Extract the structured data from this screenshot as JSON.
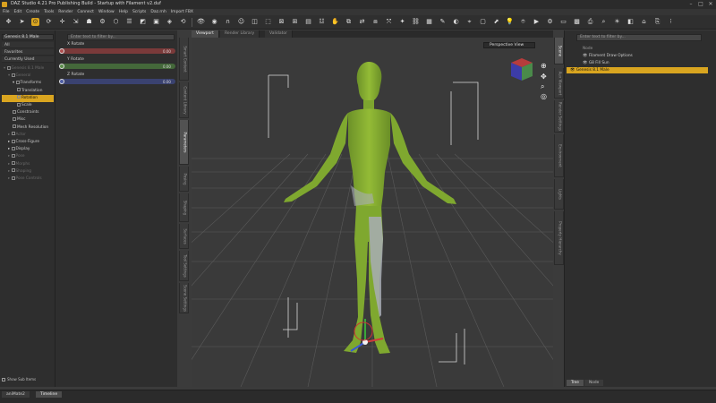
{
  "window": {
    "title": "DAZ Studio 4.21 Pro Publishing Build - Startup with Filament v2.duf"
  },
  "menu": [
    "File",
    "Edit",
    "Create",
    "Tools",
    "Render",
    "Connect",
    "Window",
    "Help",
    "Scripts",
    "Daz.rnh",
    "Import FBX"
  ],
  "left": {
    "node_selector": "Genesis 8.1 Male",
    "categories": [
      "All",
      "Favorites",
      "Currently Used"
    ],
    "tree": [
      {
        "label": "Genesis 8.1 Male",
        "indent": 0,
        "state": "dim",
        "arrow": "▾"
      },
      {
        "label": "General",
        "indent": 1,
        "state": "dim",
        "arrow": "▾"
      },
      {
        "label": "Transforms",
        "indent": 2,
        "state": "normal",
        "arrow": "▾"
      },
      {
        "label": "Translation",
        "indent": 3,
        "state": "normal",
        "arrow": ""
      },
      {
        "label": "Rotation",
        "indent": 3,
        "state": "selected",
        "arrow": ""
      },
      {
        "label": "Scale",
        "indent": 3,
        "state": "normal",
        "arrow": ""
      },
      {
        "label": "Constraints",
        "indent": 2,
        "state": "normal",
        "arrow": ""
      },
      {
        "label": "Misc",
        "indent": 2,
        "state": "normal",
        "arrow": ""
      },
      {
        "label": "Mesh Resolution",
        "indent": 2,
        "state": "normal",
        "arrow": ""
      },
      {
        "label": "Actor",
        "indent": 1,
        "state": "dim",
        "arrow": "▸"
      },
      {
        "label": "Cross-Figure",
        "indent": 1,
        "state": "normal",
        "arrow": "▸"
      },
      {
        "label": "Display",
        "indent": 1,
        "state": "normal",
        "arrow": "▸"
      },
      {
        "label": "Pose",
        "indent": 1,
        "state": "dim",
        "arrow": "▸"
      },
      {
        "label": "Morphs",
        "indent": 1,
        "state": "dim",
        "arrow": "▸"
      },
      {
        "label": "Shaping",
        "indent": 1,
        "state": "dim",
        "arrow": "▸"
      },
      {
        "label": "Pose Controls",
        "indent": 1,
        "state": "dim",
        "arrow": "▸"
      }
    ],
    "show_sub_items": "Show Sub Items"
  },
  "parameters": {
    "search_placeholder": "Enter text to filter by...",
    "items": [
      {
        "label": "X Rotate",
        "value": "0.00",
        "color": "#b05050"
      },
      {
        "label": "Y Rotate",
        "value": "0.00",
        "color": "#5c8f4c"
      },
      {
        "label": "Z Rotate",
        "value": "0.00",
        "color": "#4f5fa5"
      }
    ]
  },
  "side_tabs_left": [
    "Smart Content",
    "Content Library",
    "Parameters",
    "Posing",
    "Shaping",
    "Surfaces",
    "Tool Settings",
    "Scene Settings"
  ],
  "viewport": {
    "tabs": [
      {
        "label": "Viewport",
        "active": true
      },
      {
        "label": "Render Library",
        "active": false
      },
      {
        "label": "Validator",
        "active": false
      }
    ],
    "camera": "Perspective View"
  },
  "scene": {
    "search_placeholder": "Enter text to filter by...",
    "column": "Node",
    "rows": [
      {
        "label": "Filament Draw Options",
        "selected": false
      },
      {
        "label": "G8 Fill Sun",
        "selected": false
      },
      {
        "label": "Genesis 8.1 Male",
        "selected": true
      }
    ],
    "bottom_tabs": [
      {
        "label": "Tree",
        "active": true
      },
      {
        "label": "Node",
        "active": false
      }
    ]
  },
  "side_tabs_right": [
    "Scene",
    "Aux Viewport",
    "Render Settings",
    "Environment",
    "Lights",
    "Property Hierarchy"
  ],
  "bottom_tabs": [
    {
      "label": "aniMate2",
      "active": false
    },
    {
      "label": "Timeline",
      "active": true
    }
  ],
  "colors": {
    "accent": "#d9a520",
    "figure": "#8cb536"
  }
}
